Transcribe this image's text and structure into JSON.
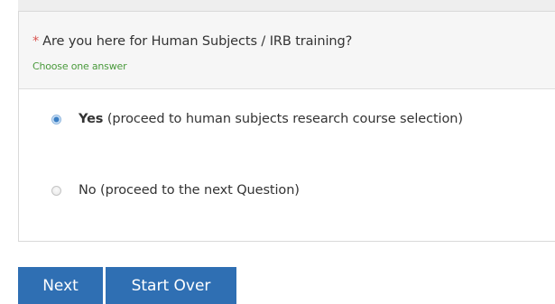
{
  "question": {
    "required_marker": "*",
    "text": "Are you here for Human Subjects / IRB training?",
    "hint": "Choose one answer"
  },
  "options": [
    {
      "bold_label": "Yes",
      "detail": "(proceed to human subjects research course selection)",
      "selected": true
    },
    {
      "bold_label": "",
      "detail": "No (proceed to the next Question)",
      "selected": false
    }
  ],
  "buttons": {
    "next_label": "Next",
    "start_over_label": "Start Over"
  },
  "colors": {
    "button_bg": "#2f6fb3",
    "required_star": "#d9534f",
    "hint_text": "#4a9a3c",
    "radio_selected": "#3b7fc4"
  },
  "icons": {
    "selected_radio": "radio-selected-icon",
    "empty_radio": "radio-empty-icon"
  }
}
